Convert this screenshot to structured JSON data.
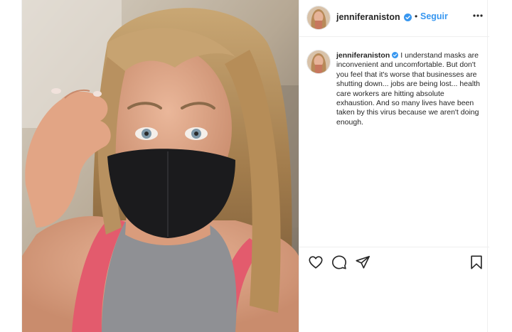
{
  "post": {
    "username": "jenniferaniston",
    "follow_label": "Seguir",
    "separator": "•",
    "caption": "I understand masks are inconvenient and uncomfortable. But don't you feel that it's worse that businesses are shutting down... jobs are being lost... health care workers are hitting absolute exhaustion. And so many lives have been taken by this virus because we aren't doing enough.",
    "icons": {
      "verified": "verified-badge-icon",
      "more": "more-options-icon",
      "like": "heart-icon",
      "comment": "comment-icon",
      "share": "share-icon",
      "save": "bookmark-icon"
    }
  },
  "colors": {
    "link_blue": "#3897f0",
    "text": "#262626",
    "divider": "#efefef",
    "verified_blue": "#3897f0"
  }
}
